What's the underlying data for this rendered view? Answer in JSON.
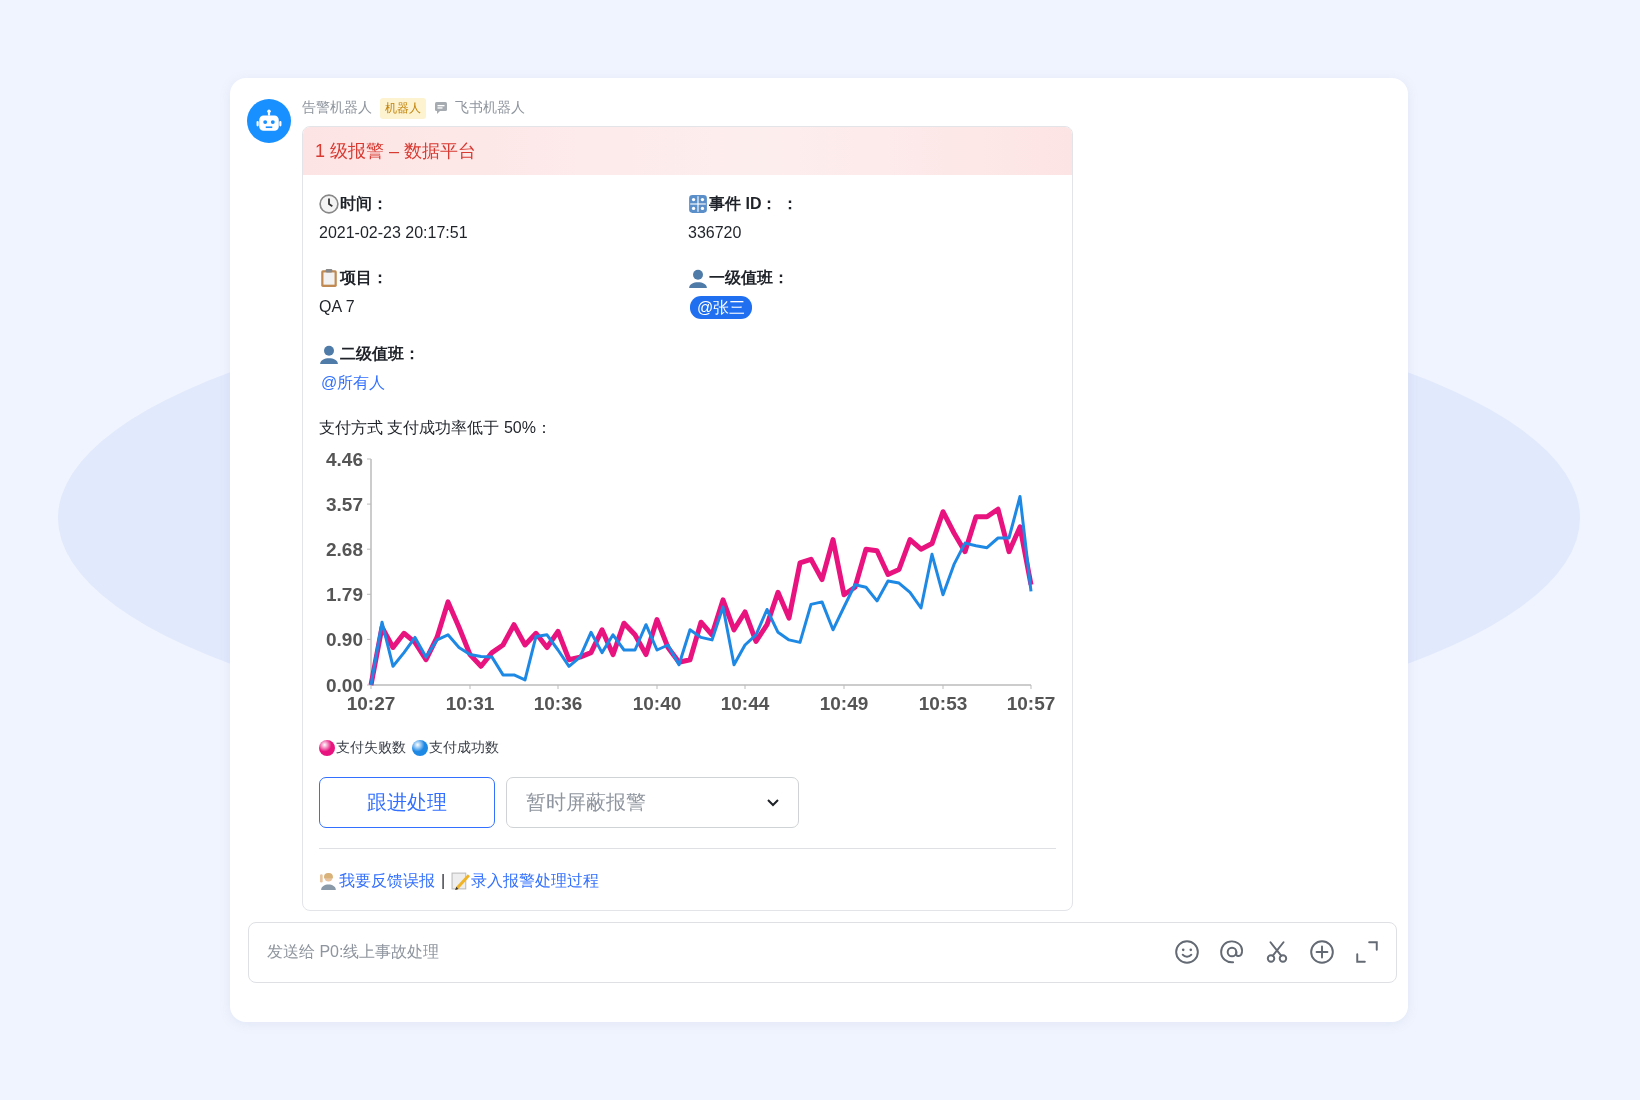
{
  "message": {
    "sender": "告警机器人",
    "badge": "机器人",
    "source": "飞书机器人"
  },
  "card": {
    "title": "1 级报警 – 数据平台",
    "fields": [
      {
        "label": "时间：",
        "value": "2021-02-23 20:17:51",
        "kind": "plain"
      },
      {
        "label": "事件 ID： ：",
        "value": "336720",
        "kind": "plain"
      },
      {
        "label": "项目：",
        "value": "QA 7",
        "kind": "plain"
      },
      {
        "label": "一级值班：",
        "value": "@张三",
        "kind": "pill"
      },
      {
        "label": "二级值班：",
        "value": "@所有人",
        "kind": "mention"
      }
    ],
    "chart_caption": "支付方式 支付成功率低于 50%：",
    "chart_data": {
      "type": "line",
      "categories": [
        "10:27",
        null,
        null,
        null,
        null,
        null,
        null,
        null,
        null,
        "10:31",
        null,
        null,
        null,
        null,
        null,
        null,
        null,
        "10:36",
        null,
        null,
        null,
        null,
        null,
        null,
        null,
        null,
        "10:40",
        null,
        null,
        null,
        null,
        null,
        null,
        null,
        "10:44",
        null,
        null,
        null,
        null,
        null,
        null,
        null,
        null,
        "10:49",
        null,
        null,
        null,
        null,
        null,
        null,
        null,
        null,
        "10:53",
        null,
        null,
        null,
        null,
        null,
        null,
        null,
        "10:57"
      ],
      "ylim": [
        0,
        4.46
      ],
      "yticks": [
        {
          "value": 0,
          "label": "0.00"
        },
        {
          "value": 0.9,
          "label": "0.90"
        },
        {
          "value": 1.79,
          "label": "1.79"
        },
        {
          "value": 2.68,
          "label": "2.68"
        },
        {
          "value": 3.57,
          "label": "3.57"
        },
        {
          "value": 4.46,
          "label": "4.46"
        }
      ],
      "series": [
        {
          "name": "支付失败数",
          "color": "#e8137e",
          "values": [
            0,
            1.14,
            0.74,
            1.02,
            0.84,
            0.5,
            0.94,
            1.64,
            1.14,
            0.6,
            0.37,
            0.64,
            0.79,
            1.19,
            0.79,
            1.02,
            0.74,
            1.06,
            0.5,
            0.55,
            0.64,
            1.09,
            0.6,
            1.22,
            0.99,
            0.6,
            1.29,
            0.74,
            0.45,
            0.5,
            1.24,
            0.99,
            1.68,
            1.09,
            1.44,
            0.86,
            1.19,
            1.83,
            1.32,
            2.41,
            2.48,
            2.08,
            2.87,
            1.78,
            1.93,
            2.68,
            2.65,
            2.18,
            2.28,
            2.87,
            2.68,
            2.79,
            3.42,
            3.0,
            2.63,
            3.32,
            3.32,
            3.47,
            2.63,
            3.12,
            1.98
          ]
        },
        {
          "name": "支付成功数",
          "color": "#1e88e5",
          "values": [
            0,
            1.24,
            0.37,
            0.64,
            0.94,
            0.55,
            0.89,
            0.99,
            0.74,
            0.6,
            0.56,
            0.55,
            0.2,
            0.2,
            0.1,
            0.96,
            0.99,
            0.69,
            0.37,
            0.55,
            1.04,
            0.64,
            0.99,
            0.69,
            0.69,
            1.19,
            0.69,
            0.79,
            0.4,
            1.09,
            0.94,
            0.89,
            1.54,
            0.4,
            0.79,
            0.99,
            1.49,
            1.04,
            0.89,
            0.84,
            1.59,
            1.64,
            1.09,
            1.54,
            1.98,
            1.93,
            1.66,
            2.05,
            2.01,
            1.83,
            1.52,
            2.58,
            1.78,
            2.38,
            2.8,
            2.75,
            2.71,
            2.9,
            2.9,
            3.72,
            1.85
          ]
        }
      ]
    },
    "actions": {
      "button": "跟进处理",
      "dropdown_placeholder": "暂时屏蔽报警"
    },
    "links": [
      {
        "text": "我要反馈误报"
      },
      {
        "text": "录入报警处理过程"
      }
    ],
    "link_separator": "|"
  },
  "composer": {
    "placeholder": "发送给 P0:线上事故处理"
  }
}
